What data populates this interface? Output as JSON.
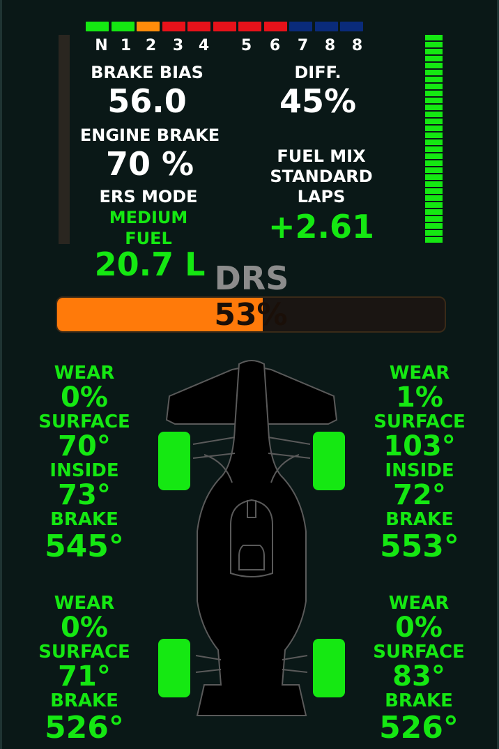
{
  "colors": {
    "green": "#15e812",
    "orange": "#ff8c0a",
    "red": "#e8121a",
    "blue": "#0a2b7a",
    "drs_fill": "#ff7a0a",
    "background": "#0a1817"
  },
  "rpm_leds": [
    "green",
    "green",
    "orange",
    "red",
    "red",
    "red",
    "red",
    "red",
    "blue",
    "blue",
    "blue"
  ],
  "gears": [
    "N",
    "1",
    "2",
    "3",
    "4",
    "5",
    "6",
    "7",
    "8",
    "8"
  ],
  "brake_bias": {
    "label": "BRAKE BIAS",
    "value": "56.0"
  },
  "diff": {
    "label": "DIFF.",
    "value": "45%"
  },
  "engine_brake": {
    "label": "ENGINE BRAKE",
    "value": "70 %"
  },
  "fuel_mix": {
    "label": "FUEL MIX",
    "value": "STANDARD"
  },
  "ers": {
    "label": "ERS MODE",
    "value": "MEDIUM"
  },
  "laps": {
    "label": "LAPS",
    "value": "+2.61"
  },
  "fuel": {
    "label": "FUEL",
    "value": "20.7 L"
  },
  "drs": {
    "label": "DRS",
    "value_text": "53%",
    "fraction": 0.53
  },
  "throttle_level_fraction": 1.0,
  "tyres": {
    "front_left": {
      "wear_label": "WEAR",
      "wear": "0%",
      "surface_label": "SURFACE",
      "surface": "70°",
      "inside_label": "INSIDE",
      "inside": "73°",
      "brake_label": "BRAKE",
      "brake": "545°"
    },
    "front_right": {
      "wear_label": "WEAR",
      "wear": "1%",
      "surface_label": "SURFACE",
      "surface": "103°",
      "inside_label": "INSIDE",
      "inside": "72°",
      "brake_label": "BRAKE",
      "brake": "553°"
    },
    "rear_left": {
      "wear_label": "WEAR",
      "wear": "0%",
      "surface_label": "SURFACE",
      "surface": "71°",
      "brake_label": "BRAKE",
      "brake": "526°"
    },
    "rear_right": {
      "wear_label": "WEAR",
      "wear": "0%",
      "surface_label": "SURFACE",
      "surface": "83°",
      "brake_label": "BRAKE",
      "brake": "526°"
    }
  }
}
